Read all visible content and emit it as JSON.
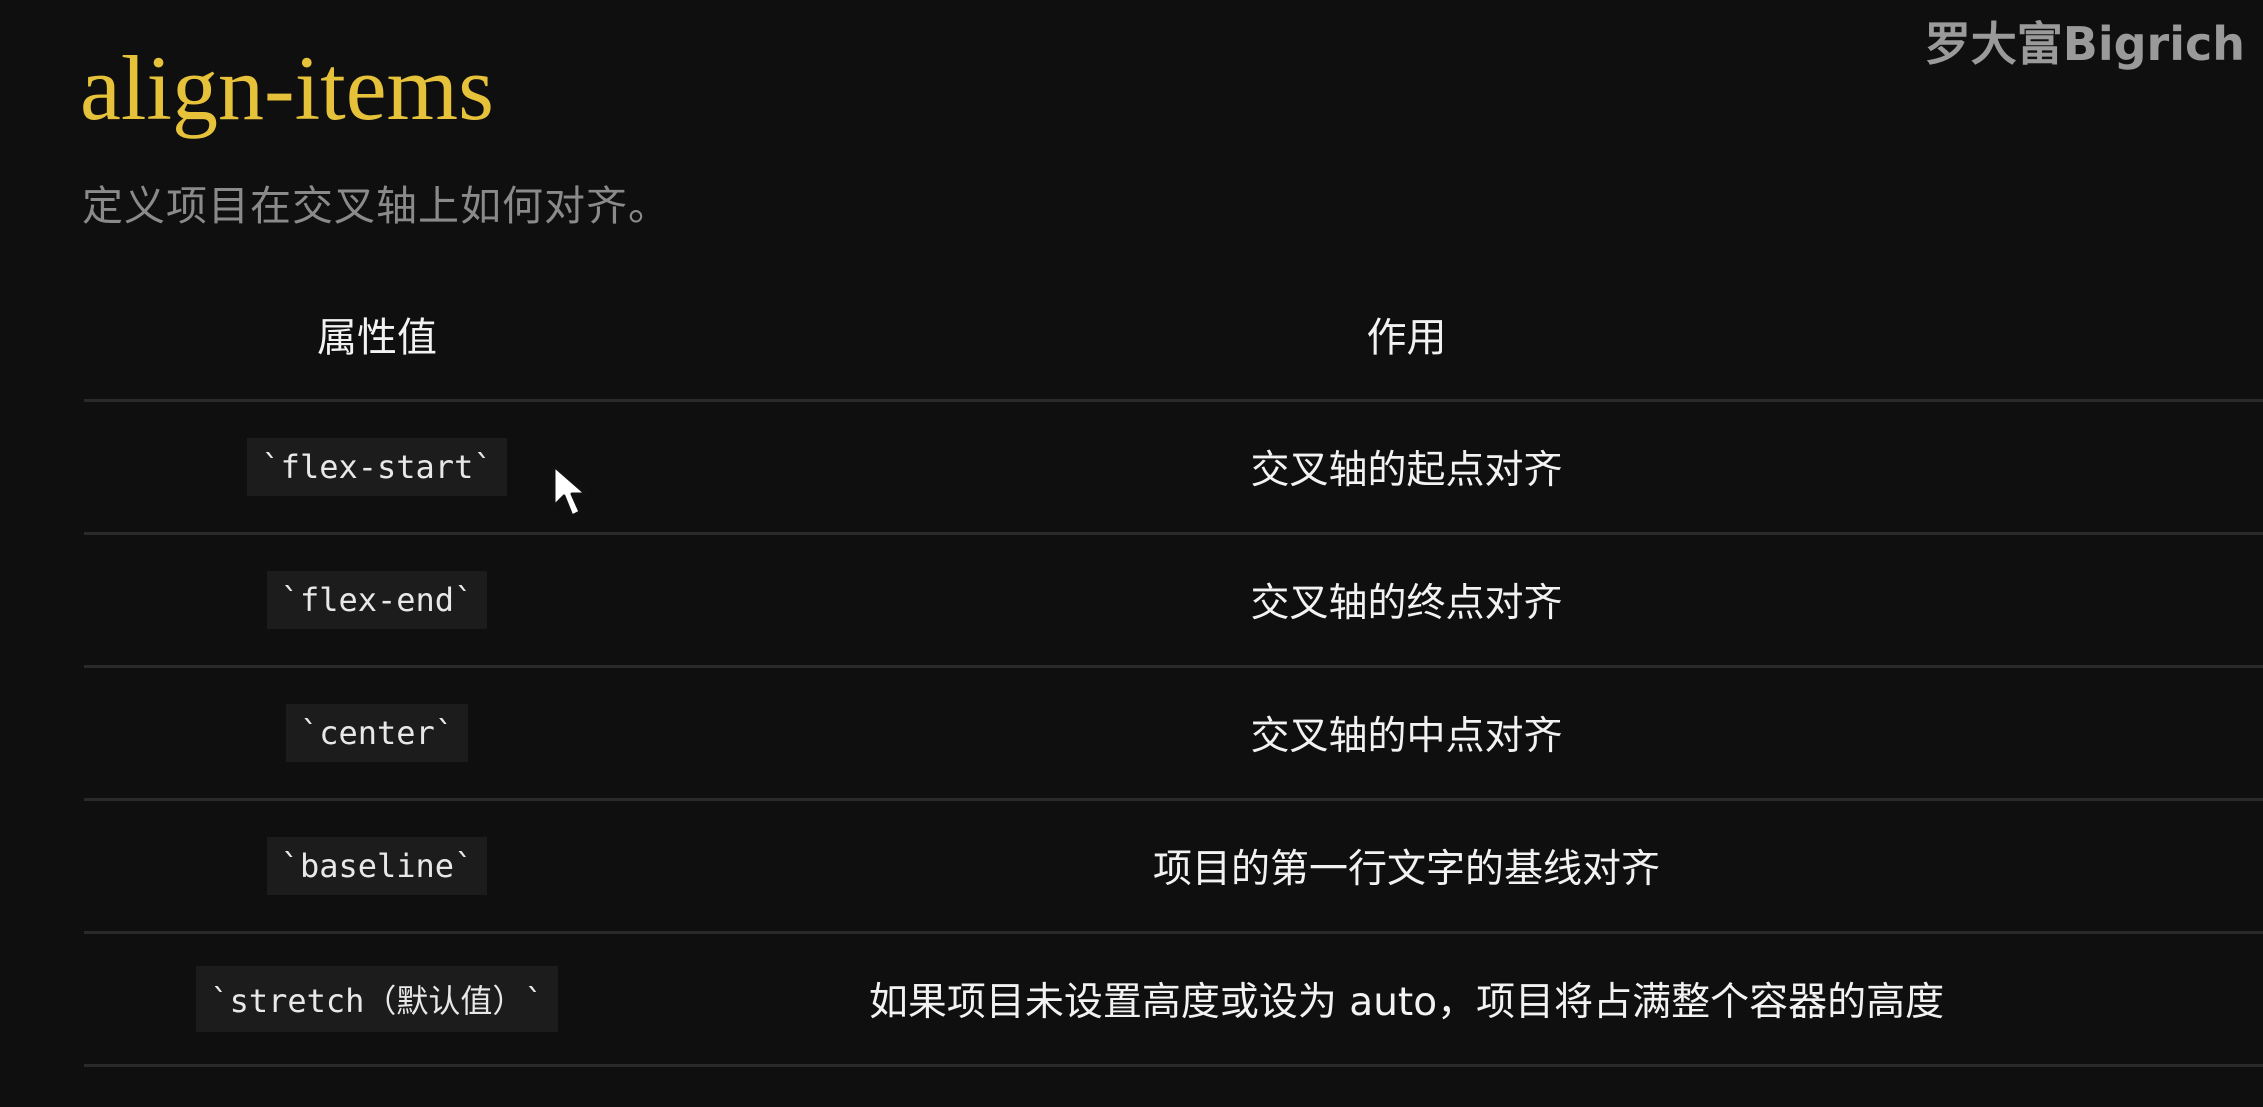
{
  "title": "align-items",
  "subtitle": "定义项目在交叉轴上如何对齐。",
  "watermark": "罗大富Bigrich",
  "table": {
    "headers": [
      "属性值",
      "作用"
    ],
    "rows": [
      {
        "value": "`flex-start`",
        "effect": "交叉轴的起点对齐"
      },
      {
        "value": "`flex-end`",
        "effect": "交叉轴的终点对齐"
      },
      {
        "value": "`center`",
        "effect": "交叉轴的中点对齐"
      },
      {
        "value": "`baseline`",
        "effect": "项目的第一行文字的基线对齐"
      },
      {
        "value": "`stretch（默认值）`",
        "effect": "如果项目未设置高度或设为 auto，项目将占满整个容器的高度"
      }
    ]
  },
  "colors": {
    "title": "#e6c23a",
    "background": "#0f0f0f",
    "subtitle": "#8a8a8a"
  },
  "icons": {
    "cursor": "mouse-pointer-icon"
  }
}
